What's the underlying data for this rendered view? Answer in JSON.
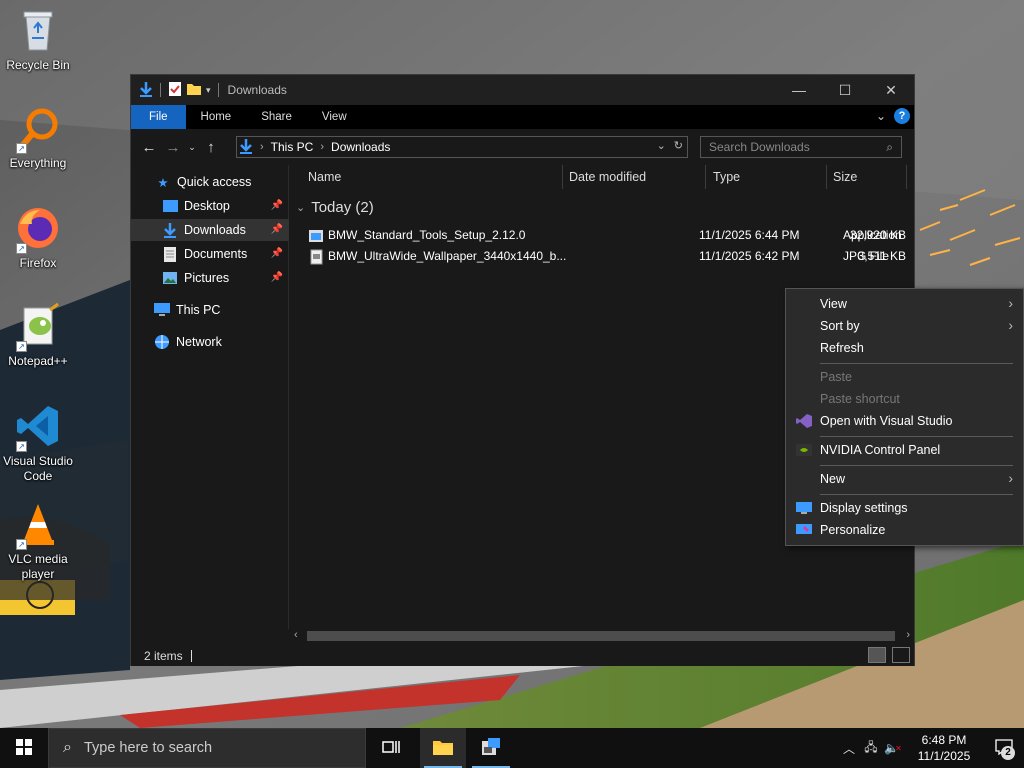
{
  "desktop": {
    "icons": [
      {
        "label": "Recycle Bin",
        "icon": "recycle-bin-icon"
      },
      {
        "label": "Everything",
        "icon": "everything-search-icon"
      },
      {
        "label": "Firefox",
        "icon": "firefox-icon"
      },
      {
        "label": "Notepad++",
        "icon": "notepad-plus-plus-icon"
      },
      {
        "label": "Visual Studio Code",
        "icon": "vscode-icon"
      },
      {
        "label": "VLC media player",
        "icon": "vlc-icon"
      }
    ]
  },
  "explorer": {
    "title": "Downloads",
    "ribbon_tabs": [
      "File",
      "Home",
      "Share",
      "View"
    ],
    "active_tab": "File",
    "address": {
      "crumbs": [
        "This PC",
        "Downloads"
      ]
    },
    "search_placeholder": "Search Downloads",
    "nav": {
      "quick_access": "Quick access",
      "items": [
        "Desktop",
        "Downloads",
        "Documents",
        "Pictures"
      ],
      "this_pc": "This PC",
      "network": "Network",
      "selected": "Downloads"
    },
    "columns": [
      "Name",
      "Date modified",
      "Type",
      "Size"
    ],
    "group_label": "Today (2)",
    "files": [
      {
        "name": "BMW_Standard_Tools_Setup_2.12.0",
        "date": "11/1/2025 6:44 PM",
        "type": "Application",
        "size": "32,920 KB"
      },
      {
        "name": "BMW_UltraWide_Wallpaper_3440x1440_b...",
        "date": "11/1/2025 6:42 PM",
        "type": "JPG File",
        "size": "3,511 KB"
      }
    ],
    "status": "2 items"
  },
  "context_menu": {
    "items": {
      "view": "View",
      "sort_by": "Sort by",
      "refresh": "Refresh",
      "paste": "Paste",
      "paste_shortcut": "Paste shortcut",
      "open_vs": "Open with Visual Studio",
      "nvidia": "NVIDIA Control Panel",
      "new": "New",
      "display_settings": "Display settings",
      "personalize": "Personalize"
    }
  },
  "taskbar": {
    "search_placeholder": "Type here to search",
    "time": "6:48 PM",
    "date": "11/1/2025",
    "notification_count": "2"
  },
  "colors": {
    "accent": "#1565c0",
    "window_bg": "#191919",
    "menu_bg": "#2b2b2b"
  }
}
